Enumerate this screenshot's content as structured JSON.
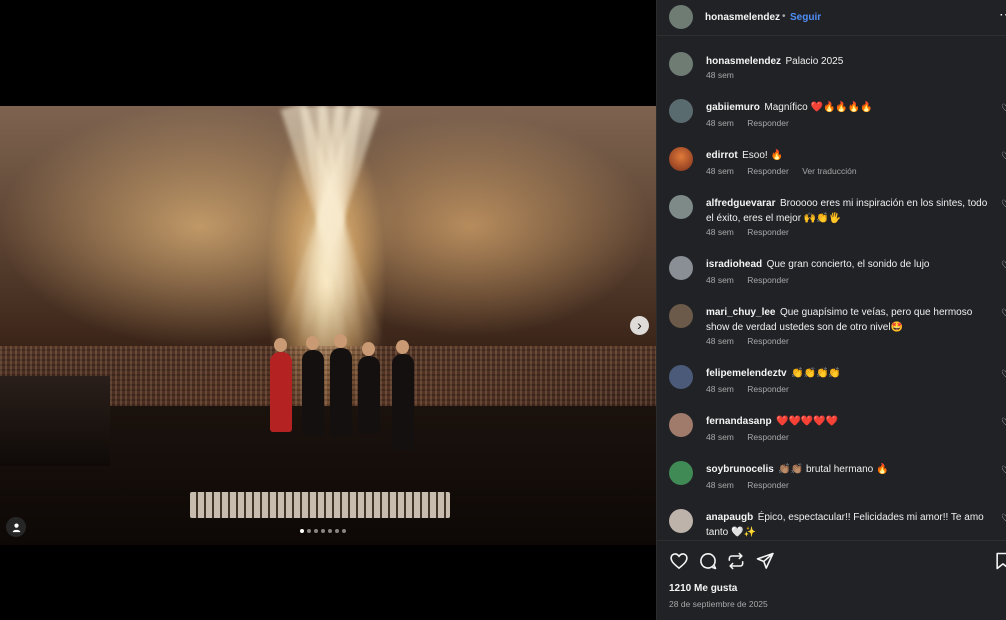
{
  "post": {
    "author": "honasmelendez",
    "separator": "•",
    "follow_label": "Seguir",
    "more_icon": "more-options-icon",
    "caption": "Palacio 2025",
    "caption_time": "48 sem",
    "likes": "1210 Me gusta",
    "date": "28 de septiembre de 2025",
    "carousel": {
      "count": 7,
      "active_index": 0
    }
  },
  "comments": [
    {
      "user": "gabiiemuro",
      "text": "Magnífico ❤️🔥🔥🔥🔥",
      "time": "48 sem",
      "reply": "Responder",
      "avatar_color": "#5a6b70"
    },
    {
      "user": "edirrot",
      "text": "Esoo! 🔥",
      "time": "48 sem",
      "reply": "Responder",
      "translate": "Ver traducción",
      "avatar_color": "#c0603a"
    },
    {
      "user": "alfredguevarar",
      "text": "Brooooo eres mi inspiración en los sintes, todo el éxito, eres el mejor 🙌👏🖐",
      "time": "48 sem",
      "reply": "Responder",
      "avatar_color": "#7d8a88"
    },
    {
      "user": "isradiohead",
      "text": "Que gran concierto, el sonido de lujo",
      "time": "48 sem",
      "reply": "Responder",
      "avatar_color": "#8a8f96"
    },
    {
      "user": "mari_chuy_lee",
      "text": "Que guapísimo te veías, pero que hermoso show de verdad ustedes son de otro nivel🤩",
      "time": "48 sem",
      "reply": "Responder",
      "avatar_color": "#6b5a4a"
    },
    {
      "user": "felipemelendeztv",
      "text": "👏👏👏👏",
      "time": "48 sem",
      "reply": "Responder",
      "avatar_color": "#4a5a78"
    },
    {
      "user": "fernandasanp",
      "text": "❤️❤️❤️❤️❤️",
      "time": "48 sem",
      "reply": "Responder",
      "avatar_color": "#a07a6a"
    },
    {
      "user": "soybrunocelis",
      "text": "👏🏽👏🏽 brutal hermano 🔥",
      "time": "48 sem",
      "reply": "Responder",
      "avatar_color": "#3f8a55"
    },
    {
      "user": "anapaugb",
      "text": "Épico, espectacular!! Felicidades mi amor!! Te amo tanto 🤍✨",
      "time": "",
      "reply": "",
      "avatar_color": "#bdb3ab"
    }
  ],
  "icons": {
    "like": "heart-icon",
    "comment": "comment-icon",
    "repost": "repost-icon",
    "share": "share-icon",
    "save": "bookmark-icon",
    "next": "chevron-right-icon",
    "tags": "user-tag-icon"
  },
  "colors": {
    "panel_bg": "#212226",
    "follow_blue": "#4f8ff7",
    "heart_red": "#ff3040"
  }
}
